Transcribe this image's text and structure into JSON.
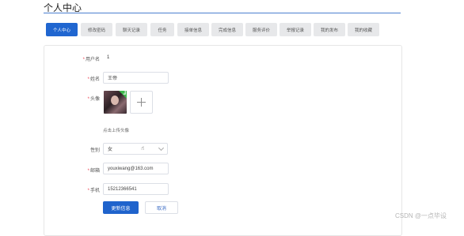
{
  "header": {
    "title": "个人中心"
  },
  "tabs": [
    {
      "label": "个人中心"
    },
    {
      "label": "修改密码"
    },
    {
      "label": "聊天记录"
    },
    {
      "label": "任务"
    },
    {
      "label": "接单信息"
    },
    {
      "label": "完成信息"
    },
    {
      "label": "服务评价"
    },
    {
      "label": "举报记录"
    },
    {
      "label": "我的发布"
    },
    {
      "label": "我的收藏"
    }
  ],
  "form": {
    "username": {
      "label": "用户名",
      "value": "1"
    },
    "name": {
      "label": "姓名",
      "value": "王帝"
    },
    "avatar": {
      "label": "头像",
      "hint": "点击上传头像"
    },
    "gender": {
      "label": "性别",
      "value": "女"
    },
    "email": {
      "label": "邮箱",
      "value": "youxiwang@163.com"
    },
    "phone": {
      "label": "手机",
      "value": "15212366541"
    },
    "required_mark": "*"
  },
  "buttons": {
    "update": "更新信息",
    "cancel": "取消"
  },
  "watermark": "CSDN @一点毕设",
  "colors": {
    "accent": "#1f63cc",
    "tab_bg": "#e7e8ea"
  },
  "icons": {
    "avatar_status": "check-icon",
    "upload": "plus-icon",
    "select": "chevron-down-icon"
  }
}
